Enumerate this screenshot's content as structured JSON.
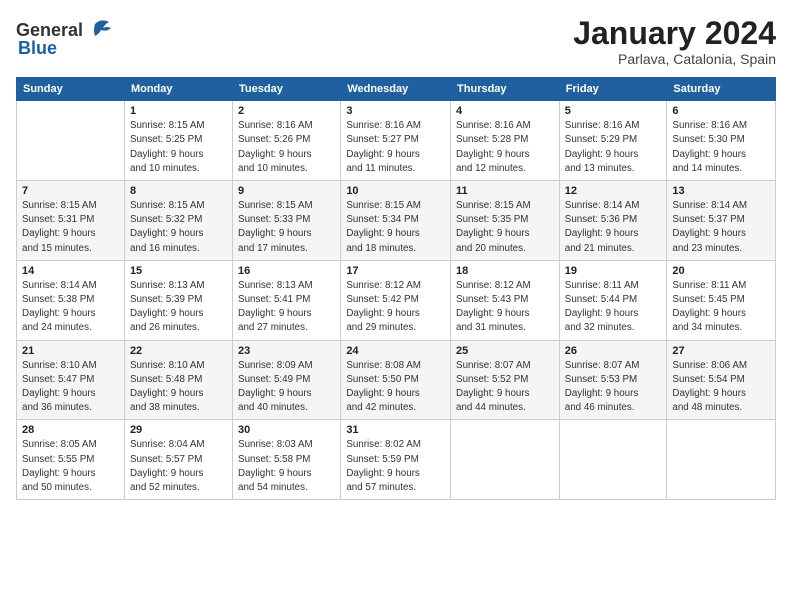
{
  "header": {
    "logo_general": "General",
    "logo_blue": "Blue",
    "title": "January 2024",
    "location": "Parlava, Catalonia, Spain"
  },
  "weekdays": [
    "Sunday",
    "Monday",
    "Tuesday",
    "Wednesday",
    "Thursday",
    "Friday",
    "Saturday"
  ],
  "weeks": [
    [
      {
        "day": "",
        "info": ""
      },
      {
        "day": "1",
        "info": "Sunrise: 8:15 AM\nSunset: 5:25 PM\nDaylight: 9 hours\nand 10 minutes."
      },
      {
        "day": "2",
        "info": "Sunrise: 8:16 AM\nSunset: 5:26 PM\nDaylight: 9 hours\nand 10 minutes."
      },
      {
        "day": "3",
        "info": "Sunrise: 8:16 AM\nSunset: 5:27 PM\nDaylight: 9 hours\nand 11 minutes."
      },
      {
        "day": "4",
        "info": "Sunrise: 8:16 AM\nSunset: 5:28 PM\nDaylight: 9 hours\nand 12 minutes."
      },
      {
        "day": "5",
        "info": "Sunrise: 8:16 AM\nSunset: 5:29 PM\nDaylight: 9 hours\nand 13 minutes."
      },
      {
        "day": "6",
        "info": "Sunrise: 8:16 AM\nSunset: 5:30 PM\nDaylight: 9 hours\nand 14 minutes."
      }
    ],
    [
      {
        "day": "7",
        "info": "Sunrise: 8:15 AM\nSunset: 5:31 PM\nDaylight: 9 hours\nand 15 minutes."
      },
      {
        "day": "8",
        "info": "Sunrise: 8:15 AM\nSunset: 5:32 PM\nDaylight: 9 hours\nand 16 minutes."
      },
      {
        "day": "9",
        "info": "Sunrise: 8:15 AM\nSunset: 5:33 PM\nDaylight: 9 hours\nand 17 minutes."
      },
      {
        "day": "10",
        "info": "Sunrise: 8:15 AM\nSunset: 5:34 PM\nDaylight: 9 hours\nand 18 minutes."
      },
      {
        "day": "11",
        "info": "Sunrise: 8:15 AM\nSunset: 5:35 PM\nDaylight: 9 hours\nand 20 minutes."
      },
      {
        "day": "12",
        "info": "Sunrise: 8:14 AM\nSunset: 5:36 PM\nDaylight: 9 hours\nand 21 minutes."
      },
      {
        "day": "13",
        "info": "Sunrise: 8:14 AM\nSunset: 5:37 PM\nDaylight: 9 hours\nand 23 minutes."
      }
    ],
    [
      {
        "day": "14",
        "info": "Sunrise: 8:14 AM\nSunset: 5:38 PM\nDaylight: 9 hours\nand 24 minutes."
      },
      {
        "day": "15",
        "info": "Sunrise: 8:13 AM\nSunset: 5:39 PM\nDaylight: 9 hours\nand 26 minutes."
      },
      {
        "day": "16",
        "info": "Sunrise: 8:13 AM\nSunset: 5:41 PM\nDaylight: 9 hours\nand 27 minutes."
      },
      {
        "day": "17",
        "info": "Sunrise: 8:12 AM\nSunset: 5:42 PM\nDaylight: 9 hours\nand 29 minutes."
      },
      {
        "day": "18",
        "info": "Sunrise: 8:12 AM\nSunset: 5:43 PM\nDaylight: 9 hours\nand 31 minutes."
      },
      {
        "day": "19",
        "info": "Sunrise: 8:11 AM\nSunset: 5:44 PM\nDaylight: 9 hours\nand 32 minutes."
      },
      {
        "day": "20",
        "info": "Sunrise: 8:11 AM\nSunset: 5:45 PM\nDaylight: 9 hours\nand 34 minutes."
      }
    ],
    [
      {
        "day": "21",
        "info": "Sunrise: 8:10 AM\nSunset: 5:47 PM\nDaylight: 9 hours\nand 36 minutes."
      },
      {
        "day": "22",
        "info": "Sunrise: 8:10 AM\nSunset: 5:48 PM\nDaylight: 9 hours\nand 38 minutes."
      },
      {
        "day": "23",
        "info": "Sunrise: 8:09 AM\nSunset: 5:49 PM\nDaylight: 9 hours\nand 40 minutes."
      },
      {
        "day": "24",
        "info": "Sunrise: 8:08 AM\nSunset: 5:50 PM\nDaylight: 9 hours\nand 42 minutes."
      },
      {
        "day": "25",
        "info": "Sunrise: 8:07 AM\nSunset: 5:52 PM\nDaylight: 9 hours\nand 44 minutes."
      },
      {
        "day": "26",
        "info": "Sunrise: 8:07 AM\nSunset: 5:53 PM\nDaylight: 9 hours\nand 46 minutes."
      },
      {
        "day": "27",
        "info": "Sunrise: 8:06 AM\nSunset: 5:54 PM\nDaylight: 9 hours\nand 48 minutes."
      }
    ],
    [
      {
        "day": "28",
        "info": "Sunrise: 8:05 AM\nSunset: 5:55 PM\nDaylight: 9 hours\nand 50 minutes."
      },
      {
        "day": "29",
        "info": "Sunrise: 8:04 AM\nSunset: 5:57 PM\nDaylight: 9 hours\nand 52 minutes."
      },
      {
        "day": "30",
        "info": "Sunrise: 8:03 AM\nSunset: 5:58 PM\nDaylight: 9 hours\nand 54 minutes."
      },
      {
        "day": "31",
        "info": "Sunrise: 8:02 AM\nSunset: 5:59 PM\nDaylight: 9 hours\nand 57 minutes."
      },
      {
        "day": "",
        "info": ""
      },
      {
        "day": "",
        "info": ""
      },
      {
        "day": "",
        "info": ""
      }
    ]
  ]
}
